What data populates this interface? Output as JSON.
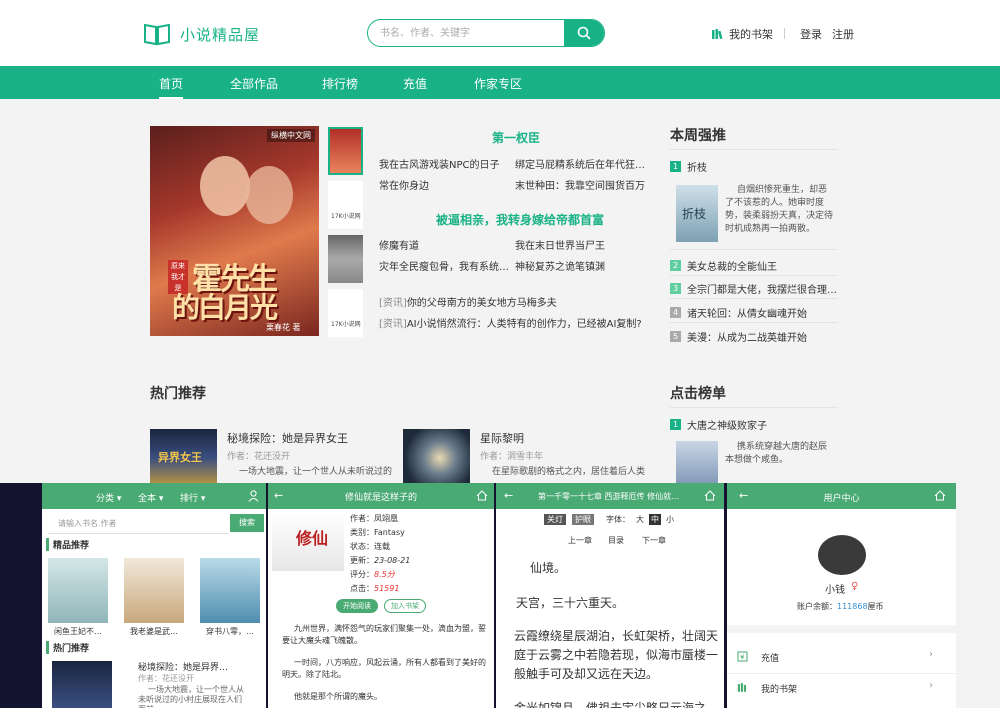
{
  "header": {
    "logo_text": "小说精品屋",
    "search_placeholder": "书名、作者、关键字",
    "shelf_label": "我的书架",
    "login_label": "登录",
    "register_label": "注册"
  },
  "nav": {
    "items": [
      "首页",
      "全部作品",
      "排行榜",
      "充值",
      "作家专区"
    ]
  },
  "featured": {
    "cover_brand": "纵横中文网",
    "cover_tag": "原来我才是",
    "cover_title_1": "霍先生",
    "cover_title_2": "的白月光",
    "cover_author": "栗春花 著",
    "thumb2_text": "17K小说网",
    "thumb4_text": "17K小说网",
    "heading_1": "第一权臣",
    "rows_1": [
      [
        "我在古风游戏装NPC的日子",
        "绑定马屁精系统后在年代狂…"
      ],
      [
        "常在你身边",
        "末世种田：我靠空间囤货百万"
      ]
    ],
    "heading_2": "被逼相亲，我转身嫁给帝都首富",
    "rows_2": [
      [
        "修魔有道",
        "我在末日世界当尸王"
      ],
      [
        "灾年全民瘦包骨，我有系统…",
        "神秘复苏之诡笔镇渊"
      ]
    ],
    "news_tag": "[资讯]",
    "news": [
      "你的父母南方的美女地方马梅多夫",
      "AI小说悄然流行：人类特有的创作力，已经被AI复制?"
    ]
  },
  "weekly": {
    "title": "本周强推",
    "top": {
      "rank": "1",
      "name": "折枝",
      "desc": "自烟织惨死重生，却恶了不该惹的人。她审时度势，装柔弱扮天真，决定待时机成熟再一拍两散。",
      "cover_text": "折枝"
    },
    "items": [
      {
        "rank": "2",
        "name": "美女总裁的全能仙王"
      },
      {
        "rank": "3",
        "name": "全宗门都是大佬，我摆烂很合理…"
      },
      {
        "rank": "4",
        "name": "诸天轮回：从倩女幽魂开始"
      },
      {
        "rank": "5",
        "name": "美漫：从成为二战英雄开始"
      }
    ]
  },
  "hot": {
    "title": "热门推荐",
    "books": [
      {
        "title": "秘境探险：她是异界女王",
        "author": "作者：花还没开",
        "desc": "一场大地震，让一个世人从未听说过的"
      },
      {
        "title": "星际黎明",
        "author": "作者：洞雪丰年",
        "desc": "在星际歌剧的格式之内，居住着后人类"
      }
    ],
    "cover_text": "异界女王"
  },
  "clicks": {
    "title": "点击榜单",
    "top": {
      "rank": "1",
      "name": "大唐之神级败家子",
      "desc": "携系统穿越大唐的赵辰本想做个咸鱼。"
    }
  },
  "mobile1": {
    "menu": [
      "分类 ▾",
      "全本 ▾",
      "排行 ▾"
    ],
    "search_placeholder": "请输入书名.作者",
    "search_button": "搜索",
    "sec1": "精品推荐",
    "books": [
      "闲鱼王妃不…",
      "我老婆是武…",
      "穿书八零，…"
    ],
    "sec2": "热门推荐",
    "hot_title": "秘境探险：她是异界…",
    "hot_author": "作者：花还没开",
    "hot_desc": "一场大地震，让一个世人从未听说过的小村庄展现在人们面前"
  },
  "mobile2": {
    "title": "修仙就是这样子的",
    "author": "作者：凤翊凰",
    "category": "类别：Fantasy",
    "status": "状态：连载",
    "update_label": "更新：",
    "update": "23-08-21",
    "score_label": "评分：",
    "score": "8.5分",
    "clicks_label": "点击：",
    "clicks": "51591",
    "read_btn": "开始阅读",
    "shelf_btn": "加入书架",
    "para1": "九州世界，满怀怨气的玩家们聚集一处，滴血为盟，誓要让大魔头魂飞魄散。",
    "para2": "一时间，八方响应，风起云涌，所有人都看到了美好的明天。除了陆北。",
    "para3": "他就是那个所谓的魔头。",
    "cover_text": "修仙"
  },
  "mobile3": {
    "title": "第一千零一十七章 西游释厄传 修仙就…",
    "light_off": "关灯",
    "eye": "护眼",
    "font_label": "字体：",
    "font_big": "大",
    "font_mid": "中",
    "font_small": "小",
    "prev": "上一章",
    "toc": "目录",
    "next": "下一章",
    "p1": "仙境。",
    "p2": "天宫，三十六重天。",
    "p3": "云霞缭绕星辰湖泊，长虹架桥，壮阔天庭于云雾之中若隐若现，似海市蜃楼一般触手可及却又远在天边。",
    "p4": "金光如锦且，佛祖去宇尖略兄元海之"
  },
  "mobile4": {
    "title": "用户中心",
    "username": "小钱",
    "gender": "♀",
    "balance_label": "账户余额：",
    "balance": "111868",
    "balance_unit": "屋币",
    "menu": [
      "充值",
      "我的书架"
    ]
  }
}
